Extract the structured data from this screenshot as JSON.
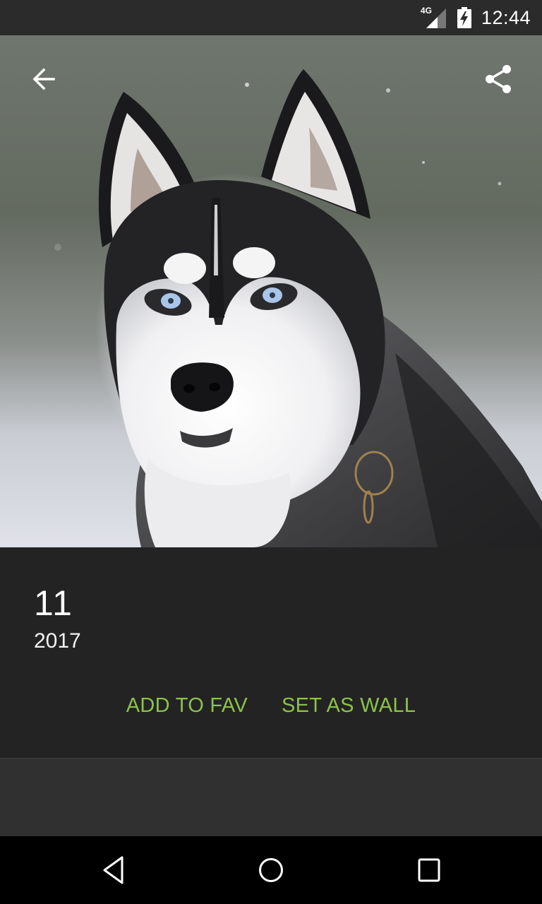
{
  "status_bar": {
    "network_label": "4G",
    "clock": "12:44",
    "icons": [
      "signal-icon",
      "battery-charging-icon"
    ]
  },
  "hero": {
    "subject": "Siberian husky portrait",
    "icons": {
      "back": "arrow-back-icon",
      "share": "share-icon"
    }
  },
  "wallpaper": {
    "title": "11",
    "year": "2017"
  },
  "actions": {
    "add_fav_label": "ADD TO FAV",
    "set_wall_label": "SET AS WALL"
  },
  "colors": {
    "accent": "#8bc34a",
    "panel": "#232323",
    "background": "#303030",
    "status_bar": "#2b2b2b",
    "nav_bar": "#000000"
  },
  "nav_bar": {
    "icons": [
      "nav-back-icon",
      "nav-home-icon",
      "nav-recents-icon"
    ]
  }
}
